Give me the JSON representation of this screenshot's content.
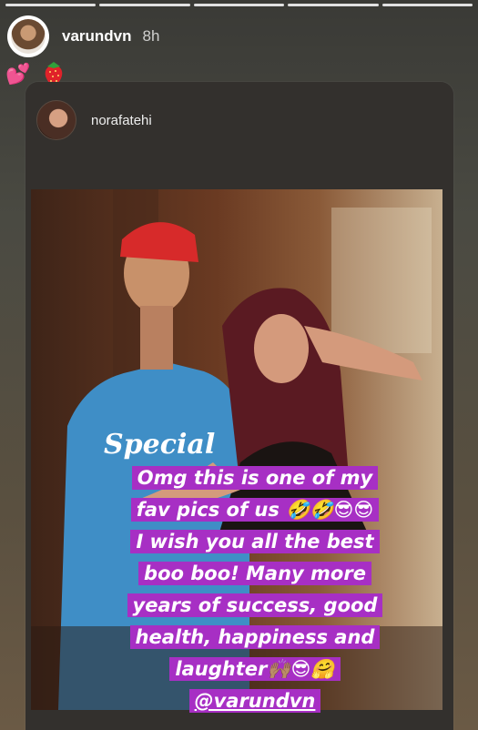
{
  "story": {
    "username": "varundvn",
    "time": "8h",
    "emojis": "💕🍓",
    "progress_segments": 5
  },
  "shared_post": {
    "username": "norafatehi"
  },
  "caption": {
    "lines": [
      "Omg this is one of my",
      "fav pics of us 🤣🤣😎😎",
      "I wish you all the best",
      "boo boo! Many more",
      "years of success, good",
      "health, happiness and",
      "laughter🙌🏽😎🤗",
      "@varundvn"
    ]
  },
  "colors": {
    "caption_highlight": "#a72fc4"
  }
}
